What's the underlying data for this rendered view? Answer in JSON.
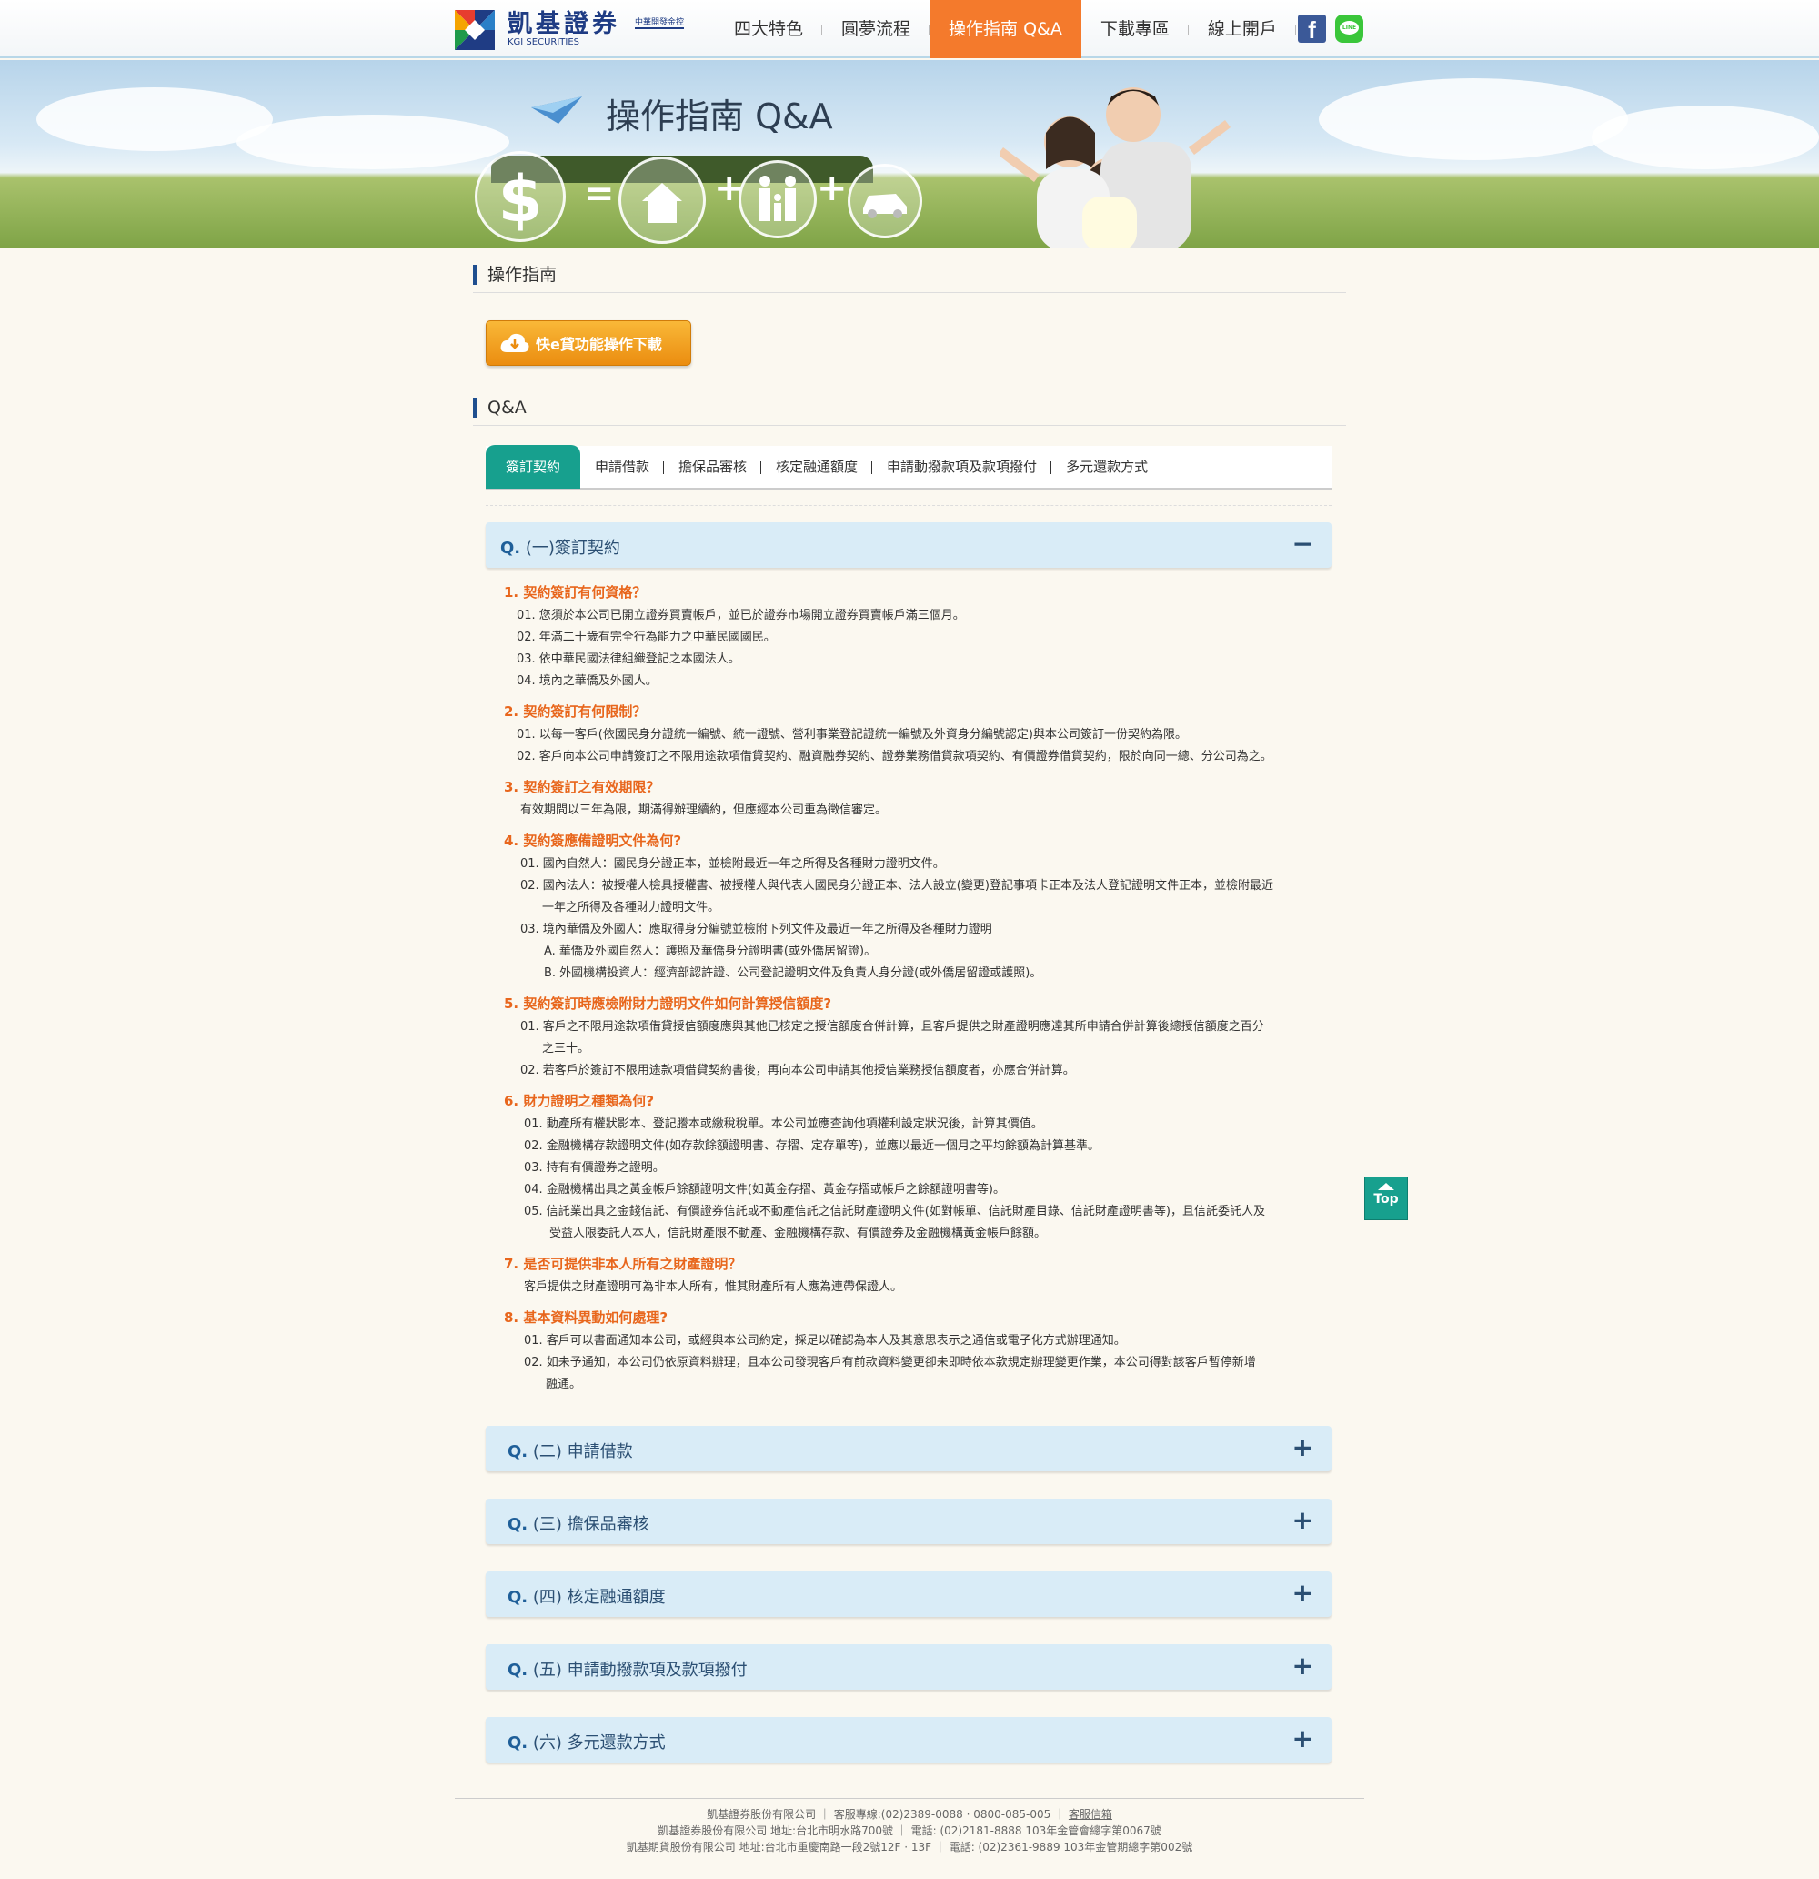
{
  "header": {
    "brand_cn": "凱基證券",
    "brand_en": "KGI SECURITIES",
    "brand_badge": "中華開發金控",
    "nav": [
      "四大特色",
      "圓夢流程",
      "操作指南 Q&A",
      "下載專區",
      "線上開戶"
    ],
    "active_nav": "操作指南 Q&A",
    "social": {
      "facebook": "f",
      "line": "LINE"
    }
  },
  "banner": {
    "title": "操作指南 Q&A",
    "dollar": "$",
    "eq": "=",
    "plus": "+"
  },
  "guide": {
    "title": "操作指南",
    "download_label": "快e貸功能操作下載"
  },
  "qa_section": {
    "title": "Q&A"
  },
  "tabs": [
    "簽訂契約",
    "申請借款",
    "擔保品審核",
    "核定融通額度",
    "申請動撥款項及款項撥付",
    "多元還款方式"
  ],
  "accordion": [
    {
      "prefix": "Q.",
      "label": "(一)簽訂契約",
      "sign": "−"
    },
    {
      "prefix": "Q.",
      "label": "(二) 申請借款",
      "sign": "+"
    },
    {
      "prefix": "Q.",
      "label": "(三) 擔保品審核",
      "sign": "+"
    },
    {
      "prefix": "Q.",
      "label": "(四) 核定融通額度",
      "sign": "+"
    },
    {
      "prefix": "Q.",
      "label": "(五) 申請動撥款項及款項撥付",
      "sign": "+"
    },
    {
      "prefix": "Q.",
      "label": "(六) 多元還款方式",
      "sign": "+"
    }
  ],
  "questions": [
    {
      "q": "1. 契約簽訂有何資格？",
      "a": [
        "01. 您須於本公司已開立證券買賣帳戶，並已於證券市場開立證券買賣帳戶滿三個月。",
        "02. 年滿二十歲有完全行為能力之中華民國國民。",
        "03. 依中華民國法律組織登記之本國法人。",
        "04. 境內之華僑及外國人。"
      ]
    },
    {
      "q": "2. 契約簽訂有何限制？",
      "a": [
        "01. 以每一客戶(依國民身分證統一編號、統一證號、營利事業登記證統一編號及外資身分編號認定)與本公司簽訂一份契約為限。",
        "02. 客戶向本公司申請簽訂之不限用途款項借貸契約、融資融券契約、證券業務借貸款項契約、有價證券借貸契約，限於向同一總、分公司為之。"
      ]
    },
    {
      "q": "3. 契約簽訂之有效期限？",
      "a": [
        "有效期間以三年為限，期滿得辦理續約，但應經本公司重為徵信審定。"
      ]
    },
    {
      "q": "4. 契約簽應備證明文件為何?",
      "a": [
        "01. 國內自然人：國民身分證正本，並檢附最近一年之所得及各種財力證明文件。",
        "02. 國內法人：被授權人檢具授權書、被授權人與代表人國民身分證正本、法人設立(變更)登記事項卡正本及法人登記證明文件正本，並檢附最近",
        "一年之所得及各種財力證明文件。",
        "03. 境內華僑及外國人：應取得身分編號並檢附下列文件及最近一年之所得及各種財力證明",
        "A. 華僑及外國自然人：護照及華僑身分證明書(或外僑居留證)。",
        "B. 外國機構投資人：經濟部認許證、公司登記證明文件及負責人身分證(或外僑居留證或護照)。"
      ]
    },
    {
      "q": "5. 契約簽訂時應檢附財力證明文件如何計算授信額度?",
      "a": [
        "01. 客戶之不限用途款項借貸授信額度應與其他已核定之授信額度合併計算，且客戶提供之財產證明應達其所申請合併計算後總授信額度之百分",
        "之三十。",
        "02. 若客戶於簽訂不限用途款項借貸契約書後，再向本公司申請其他授信業務授信額度者，亦應合併計算。"
      ]
    },
    {
      "q": "6. 財力證明之種類為何?",
      "a": [
        "01. 動產所有權狀影本、登記謄本或繳稅稅單。本公司並應查詢他項權利設定狀況後，計算其價值。",
        "02. 金融機構存款證明文件(如存款餘額證明書、存摺、定存單等)，並應以最近一個月之平均餘額為計算基準。",
        "03. 持有有價證券之證明。",
        "04. 金融機構出具之黃金帳戶餘額證明文件(如黃金存摺、黃金存摺或帳戶之餘額證明書等)。",
        "05. 信託業出具之金錢信託、有價證券信託或不動產信託之信託財產證明文件(如對帳單、信託財產目錄、信託財產證明書等)，且信託委託人及",
        "受益人限委託人本人，信託財產限不動產、金融機構存款、有價證券及金融機構黃金帳戶餘額。"
      ]
    },
    {
      "q": "7. 是否可提供非本人所有之財產證明？",
      "a": [
        "客戶提供之財產證明可為非本人所有，惟其財產所有人應為連帶保證人。"
      ]
    },
    {
      "q": "8. 基本資料異動如何處理?",
      "a": [
        "01. 客戶可以書面通知本公司，或經與本公司約定，採足以確認為本人及其意思表示之通信或電子化方式辦理通知。",
        "02. 如未予通知，本公司仍依原資料辦理，且本公司發現客戶有前款資料變更卻未即時依本款規定辦理變更作業，本公司得對該客戶暫停新增",
        "融通。"
      ]
    }
  ],
  "top_button": "Top",
  "footer": {
    "line1_company": "凱基證券股份有限公司",
    "line1_service": "客服專線:(02)2389-0088 · 0800-085-005",
    "line1_link": "客服信箱",
    "line2": "凱基證券股份有限公司 地址:台北市明水路700號 ｜ 電話: (02)2181-8888 103年金管會總字第0067號",
    "line3": "凱基期貨股份有限公司 地址:台北市重慶南路一段2號12F · 13F ｜ 電話: (02)2361-9889 103年金管期總字第002號"
  },
  "colors": {
    "accent_orange": "#f47a2c",
    "accent_teal": "#17a08e",
    "question_orange": "#e8661c",
    "accordion_bg": "#d9ecf7",
    "brand_blue": "#1f3c84"
  }
}
